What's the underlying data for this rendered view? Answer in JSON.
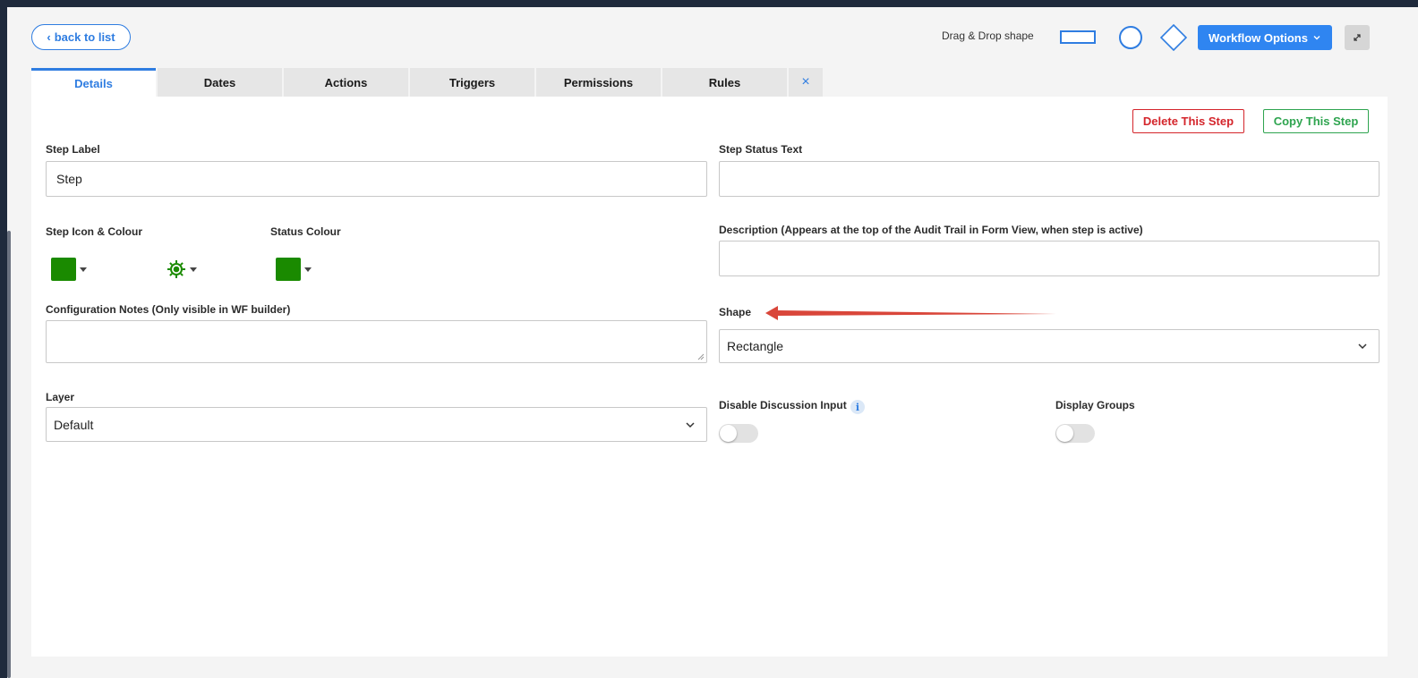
{
  "toolbar": {
    "back_label": "back to list",
    "drag_drop_label": "Drag & Drop shape",
    "workflow_options_label": "Workflow Options"
  },
  "tabs": [
    {
      "label": "Details",
      "active": true
    },
    {
      "label": "Dates"
    },
    {
      "label": "Actions"
    },
    {
      "label": "Triggers"
    },
    {
      "label": "Permissions"
    },
    {
      "label": "Rules"
    }
  ],
  "tab_close_glyph": "×",
  "actions": {
    "delete_label": "Delete This Step",
    "copy_label": "Copy This Step"
  },
  "form": {
    "step_label": {
      "label": "Step Label",
      "value": "Step"
    },
    "step_status_text": {
      "label": "Step Status Text",
      "value": ""
    },
    "step_icon_colour": {
      "label": "Step Icon & Colour",
      "colour": "#1a8a00",
      "icon": "gear-icon",
      "icon_colour": "#1a8a00"
    },
    "status_colour": {
      "label": "Status Colour",
      "colour": "#1a8a00"
    },
    "description": {
      "label": "Description (Appears at the top of the Audit Trail in Form View, when step is active)",
      "value": ""
    },
    "config_notes": {
      "label": "Configuration Notes (Only visible in WF builder)",
      "value": ""
    },
    "shape": {
      "label": "Shape",
      "value": "Rectangle"
    },
    "layer": {
      "label": "Layer",
      "value": "Default"
    },
    "disable_discussion": {
      "label": "Disable Discussion Input",
      "checked": false
    },
    "display_groups": {
      "label": "Display Groups",
      "checked": false
    }
  },
  "colors": {
    "accent": "#2f7de1",
    "danger": "#d4252b",
    "success": "#2ea44f",
    "annotation_arrow": "#d9463a"
  }
}
